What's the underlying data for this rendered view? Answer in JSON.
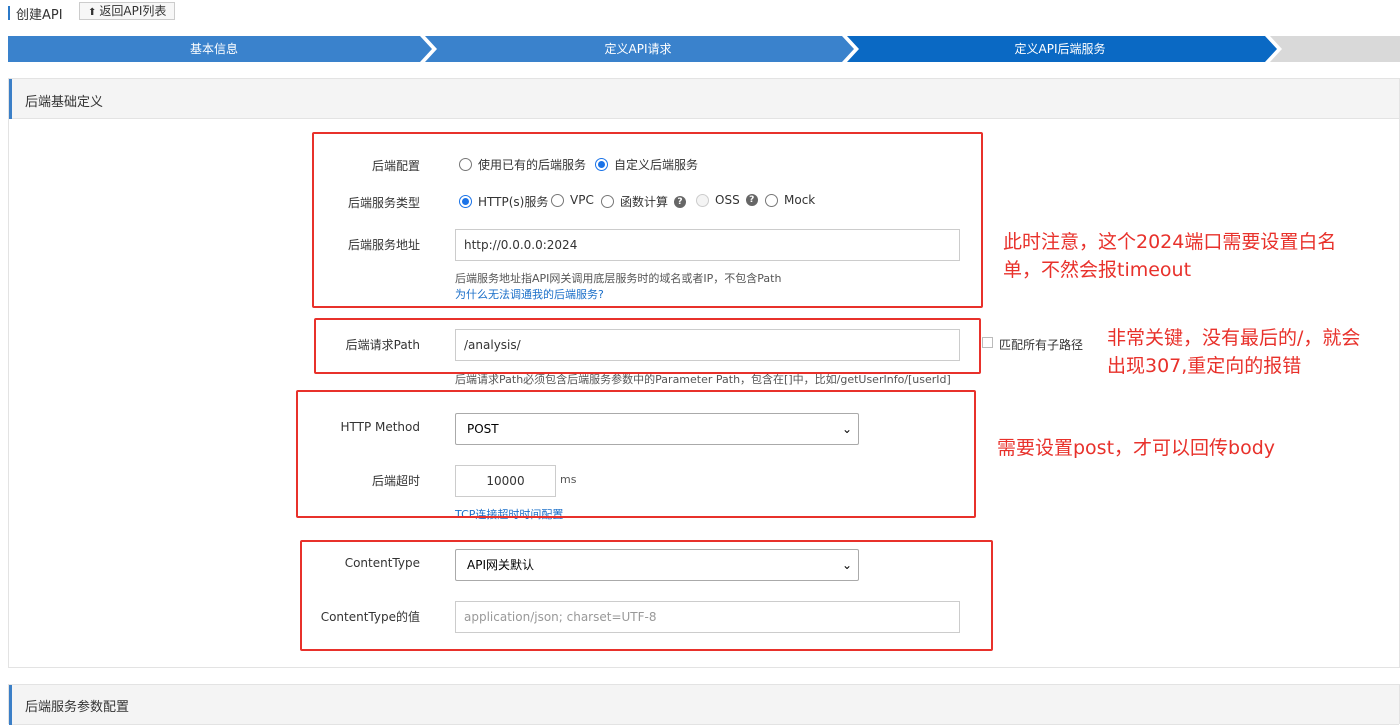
{
  "header": {
    "title": "创建API",
    "back_button": "返回API列表",
    "back_icon": "upload-arrow-icon"
  },
  "steps": [
    {
      "label": "基本信息",
      "active": false
    },
    {
      "label": "定义API请求",
      "active": false
    },
    {
      "label": "定义API后端服务",
      "active": true
    },
    {
      "label": "",
      "active": false
    }
  ],
  "colors": {
    "step_done": "#3a82cc",
    "step_active": "#0a69c4",
    "step_todo": "#d9d9d9",
    "annotation_red": "#e8312b",
    "link": "#1a6fc9"
  },
  "section1": {
    "title": "后端基础定义",
    "backend_config": {
      "label": "后端配置",
      "options": [
        "使用已有的后端服务",
        "自定义后端服务"
      ],
      "selected": "自定义后端服务"
    },
    "service_type": {
      "label": "后端服务类型",
      "options": [
        "HTTP(s)服务",
        "VPC",
        "函数计算",
        "OSS",
        "Mock"
      ],
      "selected": "HTTP(s)服务"
    },
    "service_address": {
      "label": "后端服务地址",
      "value": "http://0.0.0.0:2024",
      "note": "后端服务地址指API网关调用底层服务时的域名或者IP，不包含Path",
      "help_link": "为什么无法调通我的后端服务?"
    },
    "request_path": {
      "label": "后端请求Path",
      "value": "/analysis/",
      "match_all_label": "匹配所有子路径",
      "note": "后端请求Path必须包含后端服务参数中的Parameter Path，包含在[]中，比如/getUserInfo/[userId]"
    },
    "http_method": {
      "label": "HTTP Method",
      "value": "POST"
    },
    "timeout": {
      "label": "后端超时",
      "value": "10000",
      "unit": "ms",
      "link": "TCP连接超时时间配置"
    },
    "content_type": {
      "label": "ContentType",
      "value": "API网关默认"
    },
    "content_type_value": {
      "label": "ContentType的值",
      "placeholder": "application/json; charset=UTF-8"
    }
  },
  "section2": {
    "title": "后端服务参数配置"
  },
  "annotations": {
    "whitelist_line1": "此时注意，这个2024端口需要设置白名",
    "whitelist_line2": "单，不然会报timeout",
    "path_line1": "非常关键，没有最后的/，就会",
    "path_line2": "出现307,重定向的报错",
    "post": "需要设置post，才可以回传body"
  }
}
